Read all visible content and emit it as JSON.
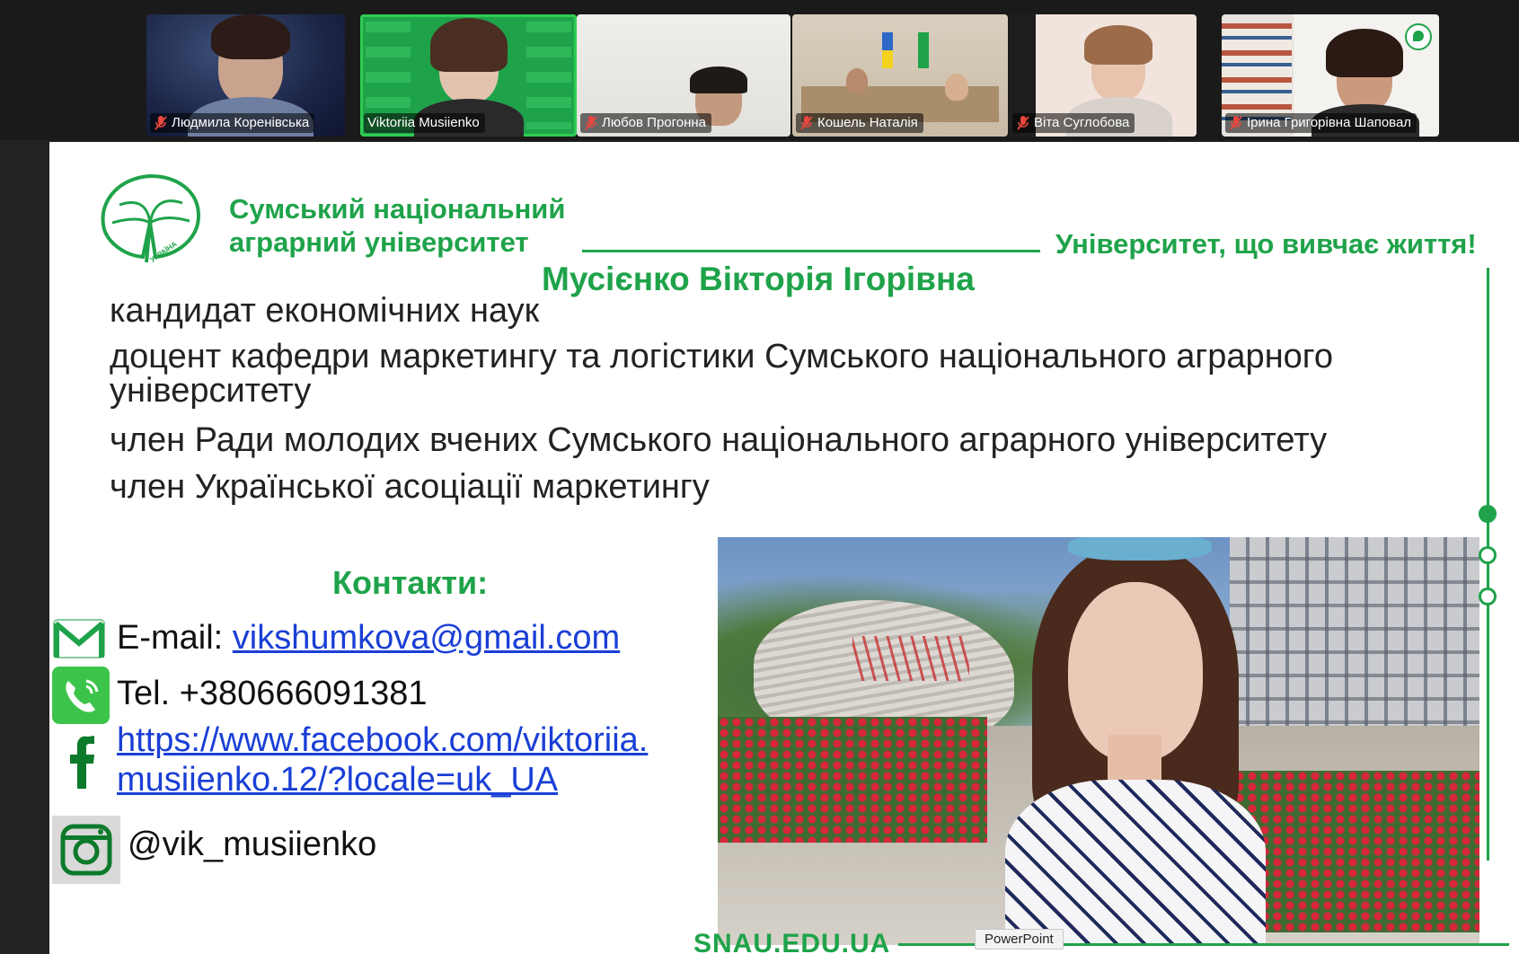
{
  "participants": [
    {
      "name": "Людмила Коренівська",
      "muted": true
    },
    {
      "name": "Viktoriia Musiienko",
      "muted": false,
      "active": true
    },
    {
      "name": "Любов Прогонна",
      "muted": true
    },
    {
      "name": "Кошель Наталія",
      "muted": true
    },
    {
      "name": "Віта Суглобова",
      "muted": true
    },
    {
      "name": "Ірина Григорівна Шаповал",
      "muted": true
    }
  ],
  "slide": {
    "university_line1": "Сумський національний",
    "university_line2": "аграрний університет",
    "logo_caption": "УКРАЇНА",
    "slogan": "Університет, що вивчає життя!",
    "person_name": "Мусієнко Вікторія Ігорівна",
    "roles": [
      "кандидат економічних наук",
      "доцент кафедри маркетингу та логістики Сумського національного аграрного університету",
      "член Ради молодих вчених Сумського національного аграрного університету",
      "член Української асоціації маркетингу"
    ],
    "contacts_title": "Контакти:",
    "email_label": "E-mail: ",
    "email": "vikshumkova@gmail.com",
    "tel": "Tel. +380666091381",
    "facebook_line1": "https://www.facebook.com/viktoriia.",
    "facebook_line2": "musiienko.12/?locale=uk_UA",
    "instagram": "@vik_musiienko",
    "footer_site": "SNAU.EDU.UA"
  },
  "tooltip": "PowerPoint",
  "colors": {
    "brand_green": "#1fa34a",
    "link_blue": "#1a3fd6"
  }
}
